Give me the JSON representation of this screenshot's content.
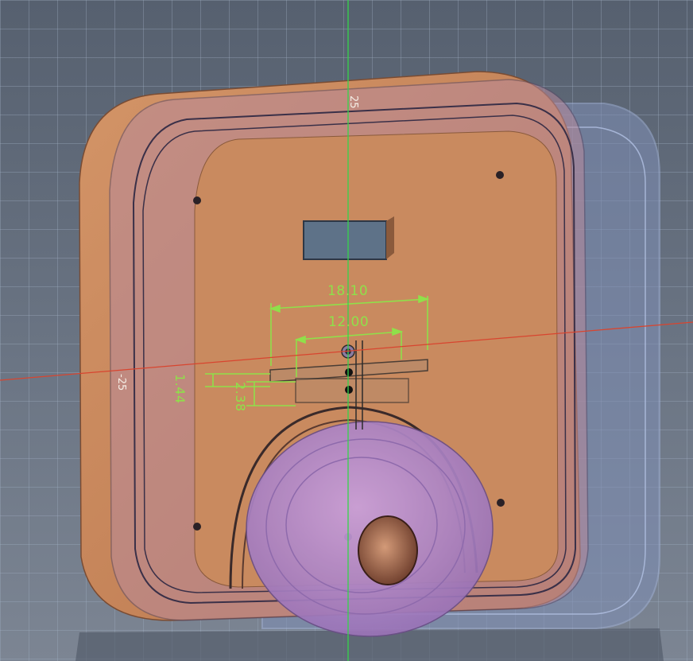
{
  "viewport": {
    "background": "#5a6678",
    "grid_color": "#a0afc3",
    "axis_x_color": "#d8452f",
    "axis_y_color": "#35d44a"
  },
  "model": {
    "body_color": "#c98a5f",
    "bezel_color": "#b88a8a",
    "ghost_body_color": "#7f8fb6",
    "knob_color": "#b48ccb"
  },
  "dimensions": {
    "outer_width": "18.10",
    "inner_width": "12.00",
    "left_offset": "1.44",
    "vertical_offset": "2.38"
  },
  "edge_labels": {
    "top": "25",
    "left": "-25"
  }
}
